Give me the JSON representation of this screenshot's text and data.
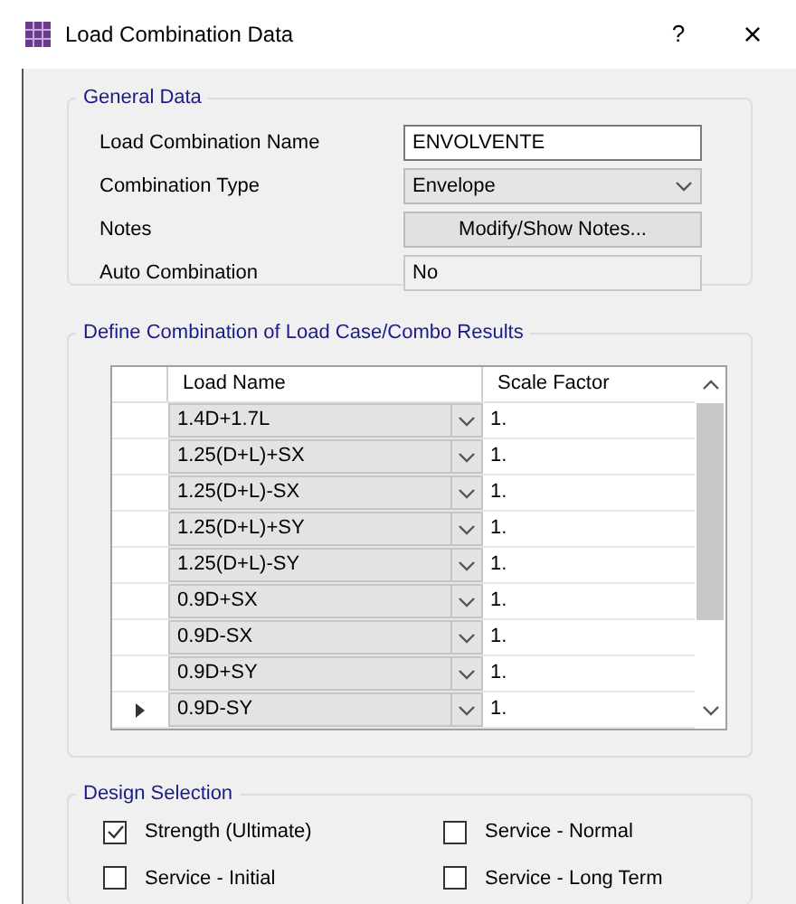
{
  "window": {
    "title": "Load Combination Data",
    "help": "?",
    "close": "×"
  },
  "general_data": {
    "title": "General Data",
    "fields": [
      {
        "kind": "text",
        "label": "Load Combination Name",
        "value": "ENVOLVENTE"
      },
      {
        "kind": "select",
        "label": "Combination Type",
        "value": "Envelope"
      },
      {
        "kind": "button",
        "label": "Notes",
        "value": "Modify/Show Notes..."
      },
      {
        "kind": "readonly",
        "label": "Auto Combination",
        "value": "No"
      }
    ]
  },
  "define_combination": {
    "title": "Define Combination of Load Case/Combo Results",
    "table": {
      "columns": [
        "Load Name",
        "Scale Factor"
      ],
      "rows": [
        {
          "load_name": "1.4D+1.7L",
          "scale_factor": "1.",
          "selected": false
        },
        {
          "load_name": "1.25(D+L)+SX",
          "scale_factor": "1.",
          "selected": false
        },
        {
          "load_name": "1.25(D+L)-SX",
          "scale_factor": "1.",
          "selected": false
        },
        {
          "load_name": "1.25(D+L)+SY",
          "scale_factor": "1.",
          "selected": false
        },
        {
          "load_name": "1.25(D+L)-SY",
          "scale_factor": "1.",
          "selected": false
        },
        {
          "load_name": "0.9D+SX",
          "scale_factor": "1.",
          "selected": false
        },
        {
          "load_name": "0.9D-SX",
          "scale_factor": "1.",
          "selected": false
        },
        {
          "load_name": "0.9D+SY",
          "scale_factor": "1.",
          "selected": false
        },
        {
          "load_name": "0.9D-SY",
          "scale_factor": "1.",
          "selected": true
        }
      ]
    }
  },
  "design_selection": {
    "title": "Design Selection",
    "options": [
      {
        "label": "Strength (Ultimate)",
        "checked": true
      },
      {
        "label": "Service - Normal",
        "checked": false
      },
      {
        "label": "Service - Initial",
        "checked": false
      },
      {
        "label": "Service - Long Term",
        "checked": false
      }
    ]
  }
}
